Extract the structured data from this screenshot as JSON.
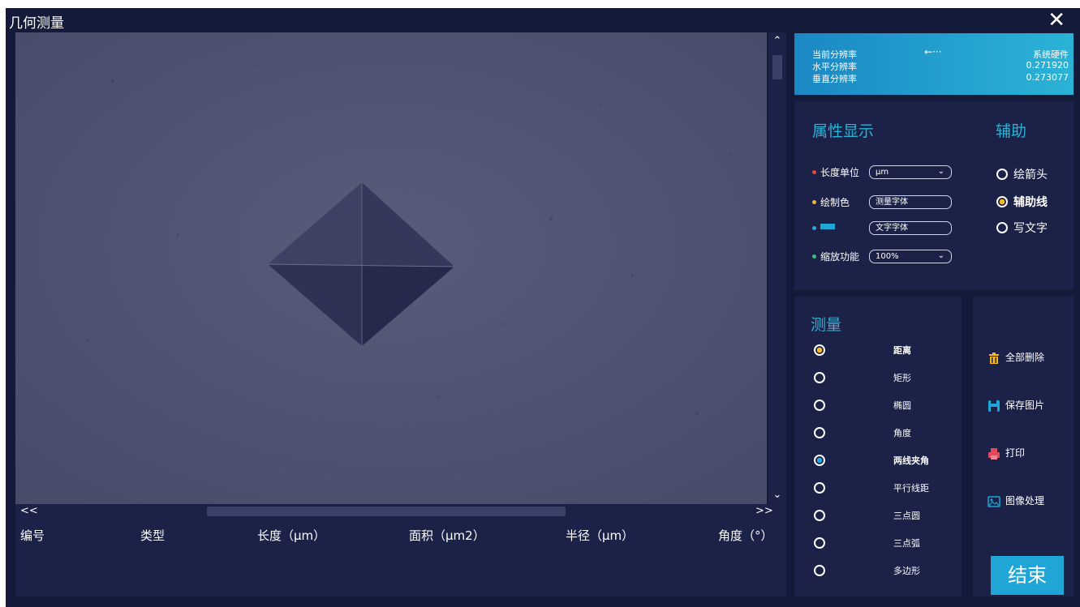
{
  "window": {
    "title": "几何测量",
    "close_glyph": "✕"
  },
  "scroll": {
    "up": "⌃",
    "down": "⌄",
    "left": "<<",
    "right": ">>"
  },
  "table": {
    "headers": [
      "编号",
      "类型",
      "长度（μm）",
      "面积（μm2）",
      "半径（μm）",
      "角度（°）"
    ]
  },
  "resolution": {
    "current_label": "当前分辨率",
    "arrow": "←···",
    "source": "系统硬件",
    "h_label": "水平分辨率",
    "h_value": "0.271920",
    "v_label": "垂直分辨率",
    "v_value": "0.273077"
  },
  "attributes": {
    "title": "属性显示",
    "unit_label": "长度单位",
    "unit_value": "μm",
    "color_label": "绘制色",
    "color_value": "测量字体",
    "text_value": "文字字体",
    "zoom_label": "缩放功能",
    "zoom_value": "100%",
    "swatch_color": "#1fa5d6",
    "dot_colors": [
      "#e24a3b",
      "#f5b829",
      "#2aa6e0",
      "#2ec27e"
    ]
  },
  "auxiliary": {
    "title": "辅助",
    "options": [
      "绘箭头",
      "辅助线",
      "写文字"
    ],
    "selected": "辅助线"
  },
  "measure": {
    "title": "测量",
    "items": [
      "距离",
      "矩形",
      "椭圆",
      "角度",
      "两线夹角",
      "平行线距",
      "三点圆",
      "三点弧",
      "多边形"
    ],
    "selected_primary": "距离",
    "selected_secondary": "两线夹角"
  },
  "actions": {
    "delete_all": "全部删除",
    "save_image": "保存图片",
    "print": "打印",
    "image_processing": "图像处理",
    "end": "结束"
  },
  "colors": {
    "background": "#141a3a",
    "panel": "#1b2147",
    "accent": "#2ab3d6",
    "selected_yellow": "#f5b829",
    "selected_blue": "#2aa6e0"
  }
}
